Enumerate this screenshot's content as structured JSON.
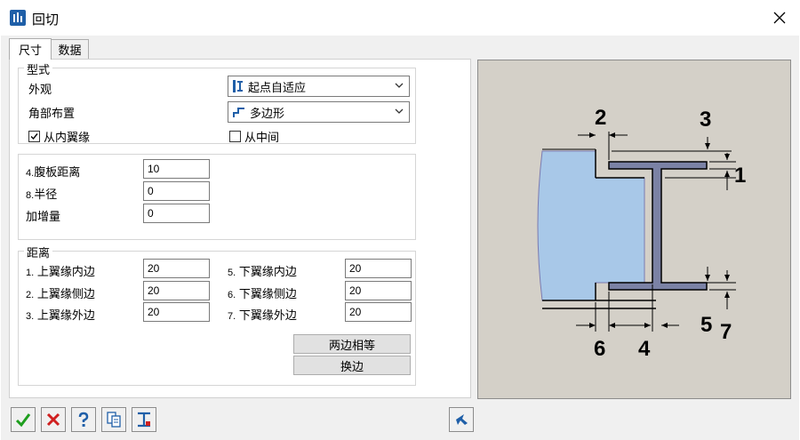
{
  "window": {
    "title": "回切"
  },
  "tabs": [
    {
      "label": "尺寸",
      "active": true
    },
    {
      "label": "数据",
      "active": false
    }
  ],
  "type_group": {
    "title": "型式",
    "appearance_label": "外观",
    "appearance_value": "起点自适应",
    "corner_label": "角部布置",
    "corner_value": "多边形",
    "from_inner_flange": {
      "label": "从内翼缘",
      "checked": true
    },
    "from_middle": {
      "label": "从中间",
      "checked": false
    }
  },
  "params_group": {
    "web_distance": {
      "num": "4.",
      "label": "腹板距离",
      "value": "10"
    },
    "radius": {
      "num": "8.",
      "label": "半径",
      "value": "0"
    },
    "increment": {
      "label": "加增量",
      "value": "0"
    }
  },
  "distance_group": {
    "title": "距离",
    "rows": [
      {
        "num": "1.",
        "label": "上翼缘内边",
        "value": "20"
      },
      {
        "num": "2.",
        "label": "上翼缘侧边",
        "value": "20"
      },
      {
        "num": "3.",
        "label": "上翼缘外边",
        "value": "20"
      },
      {
        "num": "5.",
        "label": "下翼缘内边",
        "value": "20"
      },
      {
        "num": "6.",
        "label": "下翼缘侧边",
        "value": "20"
      },
      {
        "num": "7.",
        "label": "下翼缘外边",
        "value": "20"
      }
    ],
    "equal_button": "两边相等",
    "swap_button": "换边"
  },
  "preview": {
    "labels": [
      "2",
      "3",
      "1",
      "5",
      "7",
      "6",
      "4"
    ],
    "colors": {
      "background": "#d4d0c8",
      "plate": "#a8c8e8",
      "beam": "#7b82a5"
    }
  },
  "colors": {
    "accent": "#1f5fa8",
    "ok": "#1e9e1e",
    "cancel": "#d02020"
  },
  "toolbar_icons": [
    "ok-icon",
    "cancel-icon",
    "help-icon",
    "copy-icon",
    "beam-icon",
    "pick-icon"
  ]
}
